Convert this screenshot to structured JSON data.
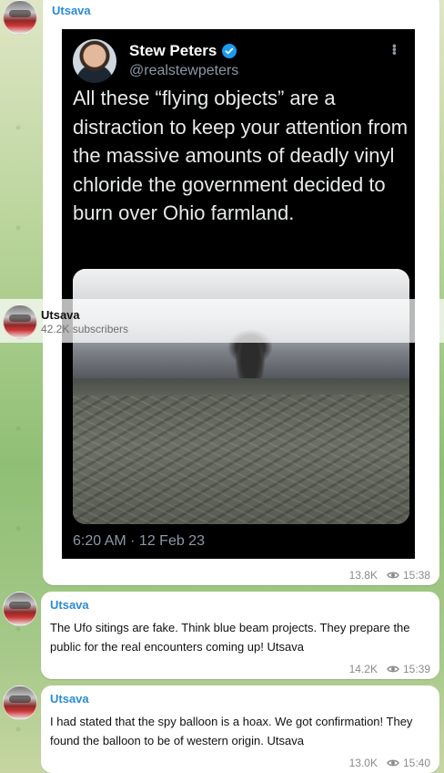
{
  "channel": {
    "name": "Utsava",
    "subscribers": "42.2K subscribers"
  },
  "posts": [
    {
      "sender": "Utsava",
      "tweet": {
        "name": "Stew Peters",
        "handle": "@realstewpeters",
        "text": "All these “flying objects” are a distraction to keep your attention from the massive amounts of deadly vinyl chloride the government decided to burn over Ohio farmland.",
        "date": "6:20 AM · 12 Feb 23"
      },
      "views": "13.8K",
      "time": "15:38"
    },
    {
      "sender": "Utsava",
      "text": "The Ufo sitings are fake. Think blue beam projects. They prepare the public for the real encounters coming up! Utsava",
      "views": "14.2K",
      "time": "15:39"
    },
    {
      "sender": "Utsava",
      "text": "I had stated that the spy balloon is a hoax. We got confirmation! They found the balloon to be of western origin. Utsava",
      "views": "13.0K",
      "time": "15:40"
    }
  ],
  "colors": {
    "sender": "#2a8bd6",
    "verified": "#1d9bf0",
    "meta": "#8c8c8c"
  },
  "icons": [
    "avatar",
    "verified-badge-icon",
    "more-options-icon",
    "views-eye-icon"
  ]
}
